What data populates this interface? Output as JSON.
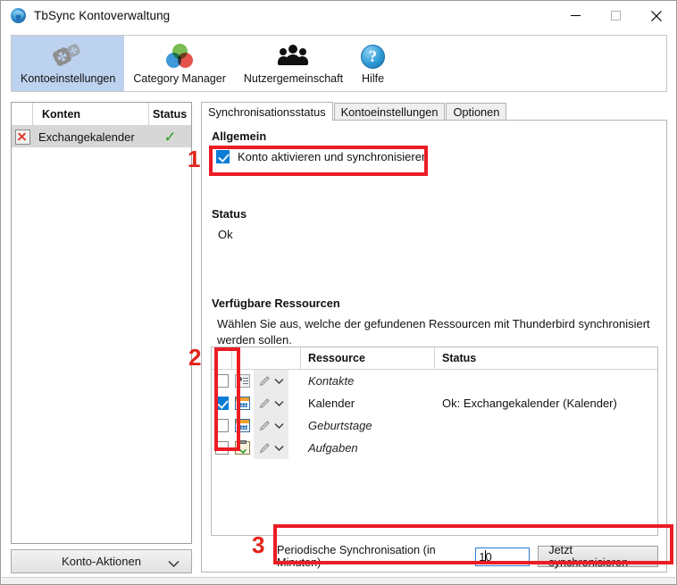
{
  "window": {
    "title": "TbSync Kontoverwaltung",
    "app_icon": "thunderbird-icon",
    "minimize": "minimize-icon",
    "maximize": "maximize-icon",
    "close": "close-icon"
  },
  "toolbar": {
    "items": [
      {
        "label": "Kontoeinstellungen",
        "icon": "gears-icon",
        "active": true
      },
      {
        "label": "Category Manager",
        "icon": "venn-circles-icon",
        "active": false
      },
      {
        "label": "Nutzergemeinschaft",
        "icon": "users-group-icon",
        "active": false
      },
      {
        "label": "Hilfe",
        "icon": "question-mark-icon",
        "active": false
      }
    ]
  },
  "accounts_pane": {
    "headers": {
      "blank": "",
      "name": "Konten",
      "status": "Status"
    },
    "rows": [
      {
        "icon": "red-x-icon",
        "name": "Exchangekalender",
        "status_icon": "green-check-icon",
        "selected": true
      }
    ],
    "actions_button": {
      "label": "Konto-Aktionen",
      "chevron": "chevron-down-icon"
    }
  },
  "tabs": [
    {
      "label": "Synchronisationsstatus",
      "active": true
    },
    {
      "label": "Kontoeinstellungen",
      "active": false
    },
    {
      "label": "Optionen",
      "active": false
    }
  ],
  "panel": {
    "general_heading": "Allgemein",
    "enable_checkbox": {
      "label": "Konto aktivieren und synchronisieren",
      "checked": true
    },
    "status_heading": "Status",
    "status_value": "Ok",
    "resources_heading": "Verfügbare Ressourcen",
    "resources_description": "Wählen Sie aus, welche der gefundenen Ressourcen mit Thunderbird synchronisiert werden sollen.",
    "table": {
      "headers": {
        "check": "",
        "actions": "",
        "resource": "Ressource",
        "status": "Status"
      },
      "rows": [
        {
          "checked": false,
          "icon": "contacts-card-icon",
          "edit": "pencil-icon",
          "menu": "chevron-down-icon",
          "resource": "Kontakte",
          "status": ""
        },
        {
          "checked": true,
          "icon": "calendar-icon",
          "edit": "pencil-icon",
          "menu": "chevron-down-icon",
          "resource": "Kalender",
          "status": "Ok: Exchangekalender (Kalender)"
        },
        {
          "checked": false,
          "icon": "calendar-icon",
          "edit": "pencil-icon",
          "menu": "chevron-down-icon",
          "resource": "Geburtstage",
          "status": ""
        },
        {
          "checked": false,
          "icon": "tasks-clipboard-icon",
          "edit": "pencil-icon",
          "menu": "chevron-down-icon",
          "resource": "Aufgaben",
          "status": ""
        }
      ]
    },
    "periodic": {
      "label": "Periodische Synchronisation (in Minuten)",
      "value": "10",
      "sync_button": "Jetzt synchronisieren"
    }
  },
  "annotations": {
    "marker_1": "1",
    "marker_2": "2",
    "marker_3": "3",
    "color": "#ec1c24"
  }
}
